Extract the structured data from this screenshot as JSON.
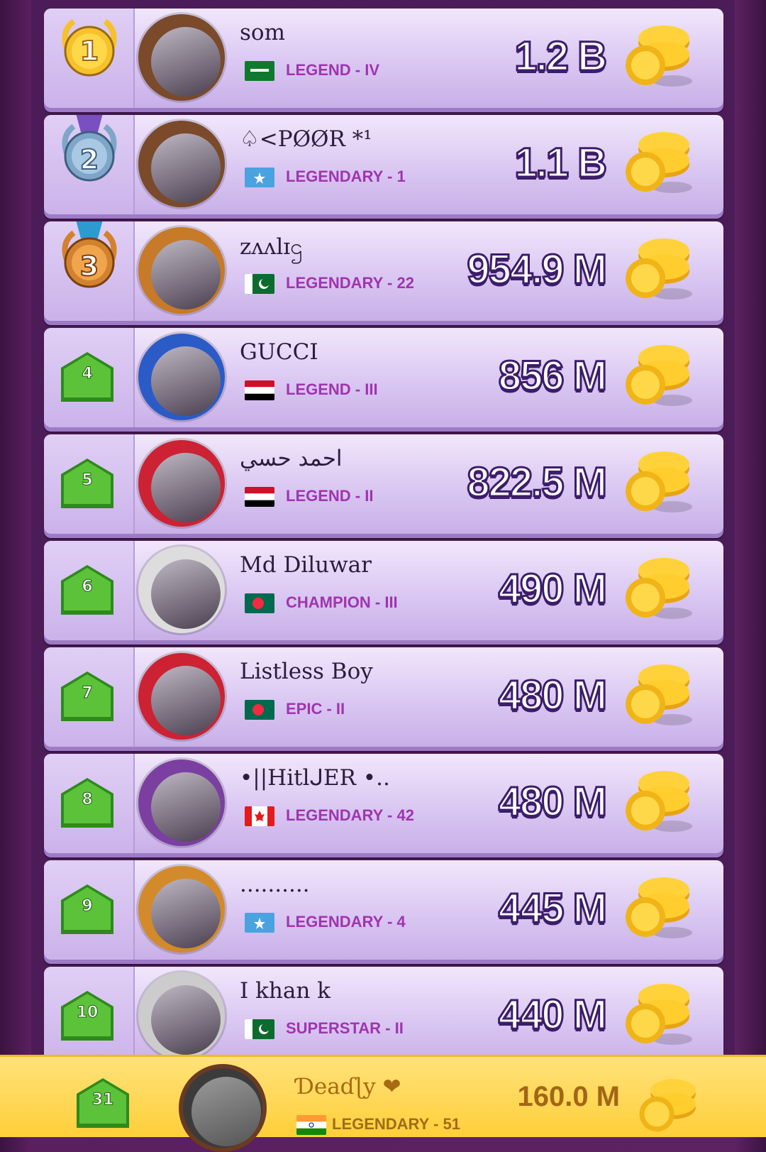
{
  "leaderboard": [
    {
      "rank": "1",
      "name": "som",
      "tier": "LEGEND - IV",
      "score": "1.2 B",
      "flag": "sa"
    },
    {
      "rank": "2",
      "name": "♤<PØØR *¹",
      "tier": "LEGENDARY - 1",
      "score": "1.1 B",
      "flag": "so"
    },
    {
      "rank": "3",
      "name": "zʌʌlɪဌ",
      "tier": "LEGENDARY - 22",
      "score": "954.9 M",
      "flag": "pk"
    },
    {
      "rank": "4",
      "name": "GUCCI",
      "tier": "LEGEND - III",
      "score": "856 M",
      "flag": "ye"
    },
    {
      "rank": "5",
      "name": "احمد حسي",
      "tier": "LEGEND - II",
      "score": "822.5 M",
      "flag": "ye"
    },
    {
      "rank": "6",
      "name": "Md Diluwar",
      "tier": "CHAMPION - III",
      "score": "490 M",
      "flag": "bd"
    },
    {
      "rank": "7",
      "name": "Listless Boy",
      "tier": "EPIC - II",
      "score": "480 M",
      "flag": "bd"
    },
    {
      "rank": "8",
      "name": "•||HitlᒍER •..",
      "tier": "LEGENDARY - 42",
      "score": "480 M",
      "flag": "ca"
    },
    {
      "rank": "9",
      "name": "..........",
      "tier": "LEGENDARY - 4",
      "score": "445 M",
      "flag": "so"
    },
    {
      "rank": "10",
      "name": "I khan k",
      "tier": "SUPERSTAR - II",
      "score": "440 M",
      "flag": "pk"
    }
  ],
  "me": {
    "rank": "31",
    "name": "Ɗeaɗɭy ❤",
    "tier": "LEGENDARY - 51",
    "score": "160.0 M",
    "flag": "in"
  },
  "avatar_colors": [
    "#7a4a2a",
    "#7a4a2a",
    "#c77a28",
    "#2b5bc6",
    "#cc2233",
    "#ddd",
    "#cc2233",
    "#7a3fa0",
    "#d38a2b",
    "#ccc"
  ],
  "colors": {
    "tier_text": "#a034b0",
    "score_stroke": "#3c1d6a",
    "footer_bg": "#ffd43e"
  },
  "icons": {
    "coin": "coin-stack-icon",
    "badge": "rank-shield-icon",
    "medal": "medal-icon"
  }
}
